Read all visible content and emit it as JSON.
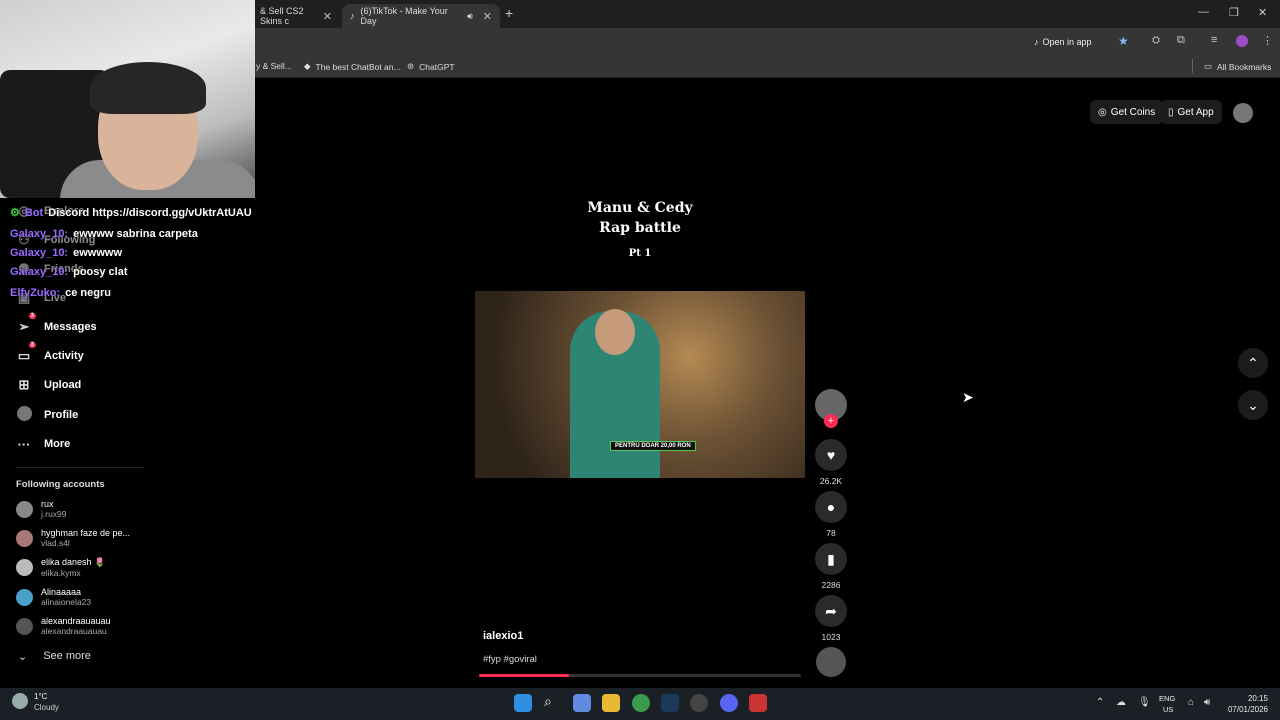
{
  "browser": {
    "tabs": [
      {
        "label": "& Sell CS2 Skins c"
      },
      {
        "label": "(6)TikTok - Make Your Day"
      }
    ],
    "open_in_app": "Open in app",
    "bookmarks": [
      "y & Sell...",
      "The best ChatBot an...",
      "ChatGPT"
    ],
    "all_bookmarks": "All Bookmarks"
  },
  "chat": [
    {
      "user": "Bot",
      "text": "Discord https://discord.gg/vUktrAtUAU"
    },
    {
      "user": "Galaxy_10:",
      "text": "ewwww sabrina carpeta"
    },
    {
      "user": "Galaxy_10:",
      "text": "ewwwww"
    },
    {
      "user": "Galaxy_10:",
      "text": "poosy clat"
    },
    {
      "user": "ElfyZuko:",
      "text": "ce negru"
    }
  ],
  "sidebar": {
    "partial_items": [
      "Explore",
      "Following",
      "Friends",
      "Live"
    ],
    "items": [
      {
        "label": "Messages",
        "icon": "paper-plane-icon",
        "badge": "3"
      },
      {
        "label": "Activity",
        "icon": "activity-icon",
        "badge": "3"
      },
      {
        "label": "Upload",
        "icon": "upload-icon",
        "badge": ""
      },
      {
        "label": "Profile",
        "icon": "profile-icon",
        "badge": ""
      },
      {
        "label": "More",
        "icon": "more-icon",
        "badge": ""
      }
    ],
    "following_title": "Following accounts",
    "accounts": [
      {
        "name": "rux",
        "handle": "j.rux99"
      },
      {
        "name": "hyghman faze de pe...",
        "handle": "vlad.s4l"
      },
      {
        "name": "elika danesh 🌷",
        "handle": "elika.kymx"
      },
      {
        "name": "Alinaaaaa",
        "handle": "alinaionela23"
      },
      {
        "name": "alexandraauauau",
        "handle": "alexandraauauau"
      }
    ],
    "see_more": "See more"
  },
  "top_actions": {
    "get_coins": "Get Coins",
    "get_app": "Get App"
  },
  "post": {
    "caption_line1": "Manu & Cedy",
    "caption_line2": "Rap battle",
    "caption_line3": "Pt 1",
    "video_label": "PENTRU DOAR 20,00 RON",
    "author": "ialexio1",
    "hashtags": "#fyp #goviral",
    "progress": 0.28,
    "likes": "26.2K",
    "comments": "78",
    "saves": "2286",
    "shares": "1023"
  },
  "taskbar": {
    "weather_temp": "1°C",
    "weather_desc": "Cloudy",
    "lang": "ENG",
    "region": "US",
    "time": "20:15",
    "date": "07/01/2026"
  },
  "colors": {
    "accent": "#fe2c55",
    "chat_user": "#9b6bff",
    "bookmark_star": "#8ab4f8"
  }
}
